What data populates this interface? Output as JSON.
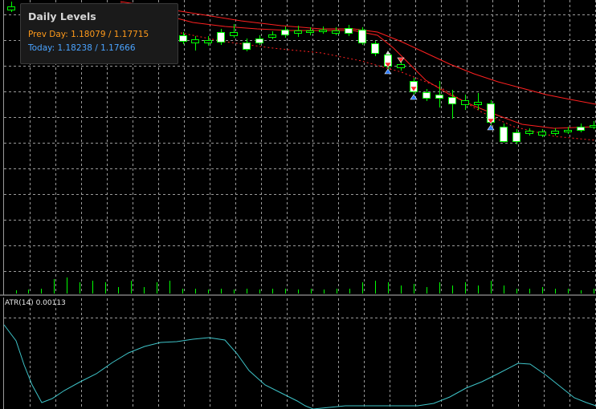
{
  "tooltip": {
    "title": "Daily Levels",
    "prev_day_label": "Prev Day:",
    "prev_day_values": "1.18079 / 1.17715",
    "today_label": "Today:",
    "today_values": "1.18238 / 1.17666"
  },
  "indicator": {
    "name": "ATR(14)",
    "value": "0.00113"
  },
  "colors": {
    "background": "#000000",
    "grid": "#9a9a9a",
    "bull_candle": "#ffffff",
    "bear_candle": "#000000",
    "candle_wick": "#00ff00",
    "moving_average": "#ff2020",
    "volume": "#00ff00",
    "atr_line": "#3ec3c8",
    "prev_day_text": "#ff9a1a",
    "today_text": "#4aa3ff",
    "arrow_sell": "#ff2a2a",
    "arrow_buy": "#2d7bff"
  },
  "icons": {
    "sell_signal": "arrow-down-icon",
    "buy_signal": "arrow-up-icon"
  }
}
